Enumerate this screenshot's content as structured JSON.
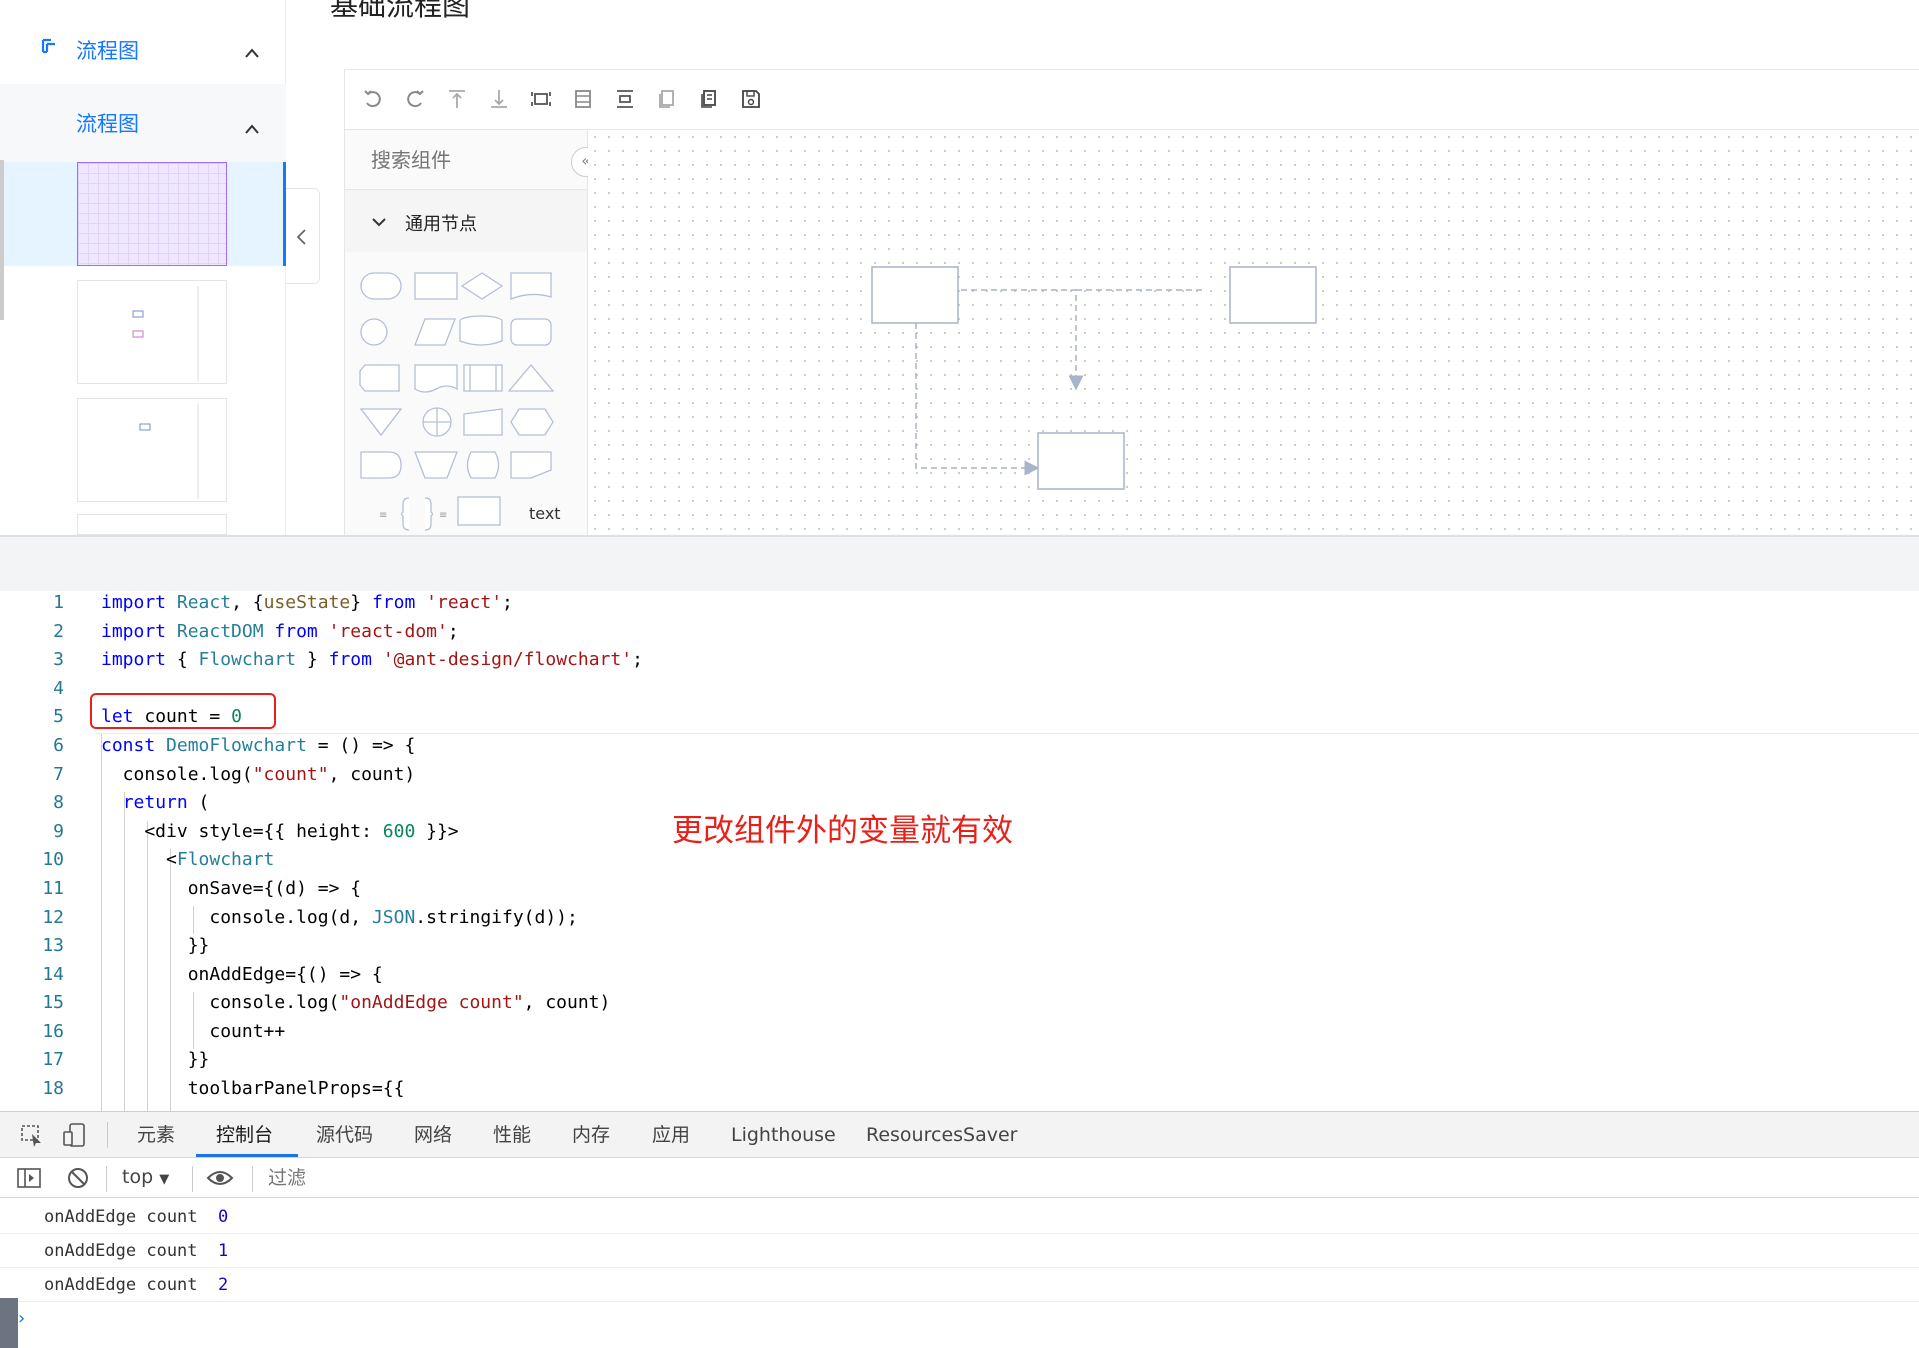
{
  "page": {
    "title_partial": "基础流程图"
  },
  "sidebar": {
    "header_label": "流程图",
    "sub_label": "流程图",
    "colors": {
      "accent": "#1677ff",
      "selected_bg": "#e6f4ff",
      "selected_thumb_bg": "#efe7ff"
    }
  },
  "toolbar": {
    "icons": [
      "undo-icon",
      "redo-icon",
      "align-top-icon",
      "align-bottom-icon",
      "fit-view-icon",
      "align-center-icon",
      "distribute-icon",
      "copy-icon",
      "paste-icon",
      "save-icon"
    ]
  },
  "panel": {
    "search_placeholder": "搜索组件",
    "group_label": "通用节点",
    "text_shape_label": "text"
  },
  "code": {
    "lines": [
      {
        "n": "1"
      },
      {
        "n": "2"
      },
      {
        "n": "3"
      },
      {
        "n": "4"
      },
      {
        "n": "5"
      },
      {
        "n": "6"
      },
      {
        "n": "7"
      },
      {
        "n": "8"
      },
      {
        "n": "9"
      },
      {
        "n": "10"
      },
      {
        "n": "11"
      },
      {
        "n": "12"
      },
      {
        "n": "13"
      },
      {
        "n": "14"
      },
      {
        "n": "15"
      },
      {
        "n": "16"
      },
      {
        "n": "17"
      },
      {
        "n": "18"
      }
    ],
    "annotation": "更改组件外的变量就有效",
    "annotation_color": "#e8201a"
  },
  "devtools": {
    "tabs": [
      "元素",
      "控制台",
      "源代码",
      "网络",
      "性能",
      "内存",
      "应用",
      "Lighthouse",
      "ResourcesSaver"
    ],
    "active_tab": "控制台",
    "context": "top",
    "filter_placeholder": "过滤",
    "logs": [
      {
        "text": "onAddEdge count",
        "value": "0"
      },
      {
        "text": "onAddEdge count",
        "value": "1"
      },
      {
        "text": "onAddEdge count",
        "value": "2"
      }
    ]
  }
}
